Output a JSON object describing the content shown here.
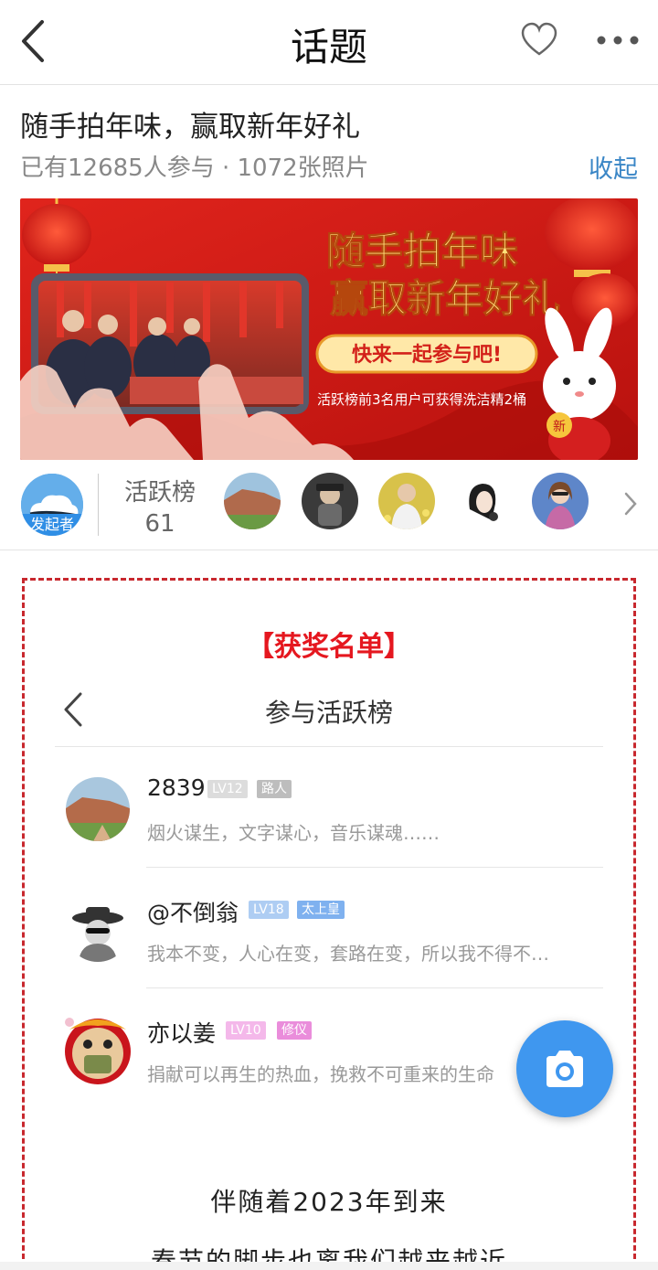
{
  "header": {
    "title": "话题"
  },
  "topic": {
    "title": "随手拍年味，赢取新年好礼",
    "meta": "已有12685人参与 · 1072张照片",
    "collapse_label": "收起"
  },
  "banner": {
    "headline_1": "随手拍年味",
    "headline_2": "赢取新年好礼",
    "cta": "快来一起参与吧!",
    "note": "活跃榜前3名用户可获得洗洁精2桶",
    "stamp": "新"
  },
  "active": {
    "initiator_badge": "发起者",
    "rank_label": "活跃榜",
    "rank_count": "61"
  },
  "award": {
    "title": "【获奖名单】",
    "inner_title": "参与活跃榜",
    "users": [
      {
        "name": "2839",
        "level": "LV12",
        "rank": "路人",
        "bio": "烟火谋生，文字谋心，音乐谋魂……"
      },
      {
        "name": "@不倒翁",
        "level": "LV18",
        "rank": "太上皇",
        "bio": "我本不变，人心在变，套路在变，所以我不得不…"
      },
      {
        "name": "亦以姜",
        "level": "LV10",
        "rank": "修仪",
        "bio": "捐献可以再生的热血，挽救不可重来的生命"
      }
    ],
    "poem_1": "伴随着2023年到来",
    "poem_2": "春节的脚步也离我们越来越近"
  },
  "colors": {
    "accent_blue": "#3f97ef",
    "award_red": "#e5171f",
    "link_blue": "#3a86c6"
  }
}
